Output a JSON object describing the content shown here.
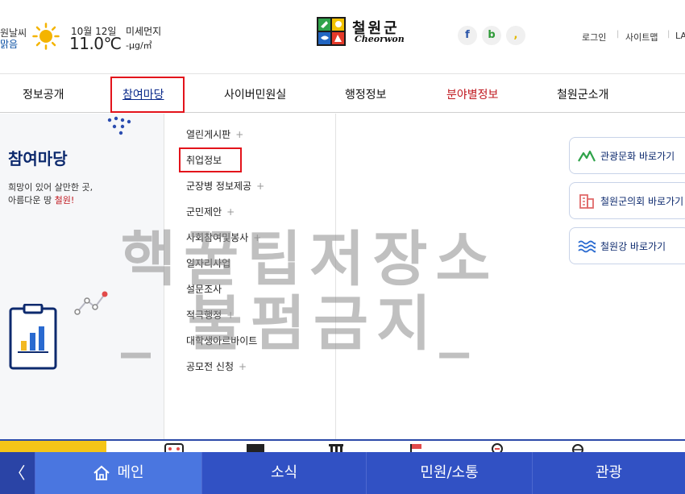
{
  "weather": {
    "city": "원날씨",
    "condition": "맑음",
    "date": "10월 12일",
    "temperature": "11.0℃",
    "dust_label": "미세먼지",
    "dust_value": "-μg/㎥"
  },
  "logo": {
    "name_kr": "철원군",
    "name_en": "Cheorwon"
  },
  "social": {
    "facebook": "f",
    "blog": "b",
    "kakao": ","
  },
  "util_links": {
    "login": "로그인",
    "sitemap": "사이트맵",
    "language": "LA"
  },
  "gnb": {
    "items": [
      "정보공개",
      "참여마당",
      "사이버민원실",
      "행정정보",
      "분야별정보",
      "철원군소개"
    ]
  },
  "mega": {
    "title": "참여마당",
    "desc_line1": "희망이 있어 살만한 곳,",
    "desc_line2_prefix": "아름다운 땅 ",
    "desc_line2_highlight": "철원!",
    "submenu": [
      "열린게시판",
      "취업정보",
      "군장병 정보제공",
      "군민제안",
      "사회참여및봉사",
      "일자리사업",
      "설문조사",
      "적극행정",
      "대학생아르바이트",
      "공모전 신청"
    ],
    "plus": "+",
    "quick_links": [
      "관광문화 바로가기",
      "철원군의회 바로가기",
      "철원강 바로가기"
    ]
  },
  "watermark": {
    "line1": "핵꿀팁저장소",
    "line2": "_ 불펌금지_"
  },
  "bottom_nav": {
    "prev": "〈",
    "tabs": [
      "메인",
      "소식",
      "민원/소통",
      "관광"
    ]
  },
  "colors": {
    "primary": "#3151c4",
    "accent_red": "#c0181f",
    "navy": "#0d2a6e",
    "highlight_box": "#e3131b"
  }
}
